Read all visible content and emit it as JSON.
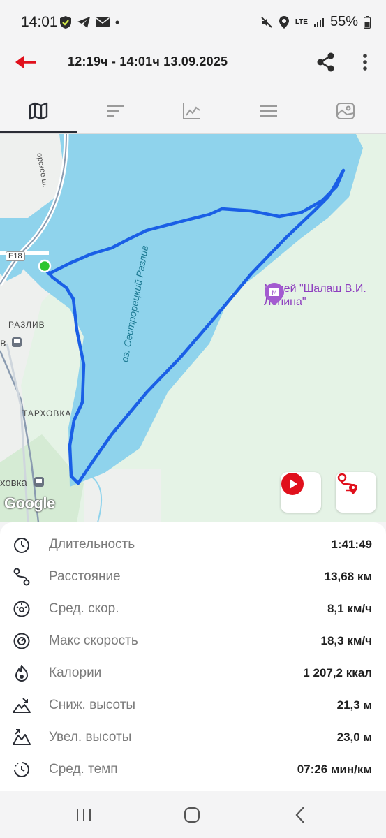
{
  "status": {
    "time": "14:01",
    "network": "LTE",
    "battery": "55%"
  },
  "header": {
    "title": "12:19ч - 14:01ч   13.09.2025"
  },
  "tabs": [
    {
      "name": "map-icon"
    },
    {
      "name": "list-sort-icon"
    },
    {
      "name": "chart-icon"
    },
    {
      "name": "menu-lines-icon"
    },
    {
      "name": "photo-icon"
    }
  ],
  "map": {
    "labels": {
      "road": "E18",
      "razliv": "РАЗЛИВ",
      "tarkhovka": "ТАРХОВКА",
      "tarkhovka_station": "ховка",
      "station_v": "в",
      "highway": "орское ш.",
      "lake": "оз. Сестрорецкий Разлив",
      "poi": "Музей \"Шалаш В.И. Ленина\"",
      "google": "Google"
    }
  },
  "stats": [
    {
      "label": "Длительность",
      "value": "1:41:49",
      "icon": "timer-icon"
    },
    {
      "label": "Расстояние",
      "value": "13,68 км",
      "icon": "route-icon"
    },
    {
      "label": "Сред. скор.",
      "value": "8,1 км/ч",
      "icon": "speedometer-icon"
    },
    {
      "label": "Макс скорость",
      "value": "18,3 км/ч",
      "icon": "max-speed-icon"
    },
    {
      "label": "Калории",
      "value": "1 207,2 ккал",
      "icon": "flame-icon"
    },
    {
      "label": "Сниж. высоты",
      "value": "21,3 м",
      "icon": "descent-icon"
    },
    {
      "label": "Увел. высоты",
      "value": "23,0 м",
      "icon": "ascent-icon"
    },
    {
      "label": "Сред. темп",
      "value": "07:26 мин/км",
      "icon": "pace-icon"
    }
  ],
  "colors": {
    "accent": "#e0101c",
    "track": "#1a5fe6",
    "water": "#8fd3ec",
    "land": "#e5f3e6"
  }
}
